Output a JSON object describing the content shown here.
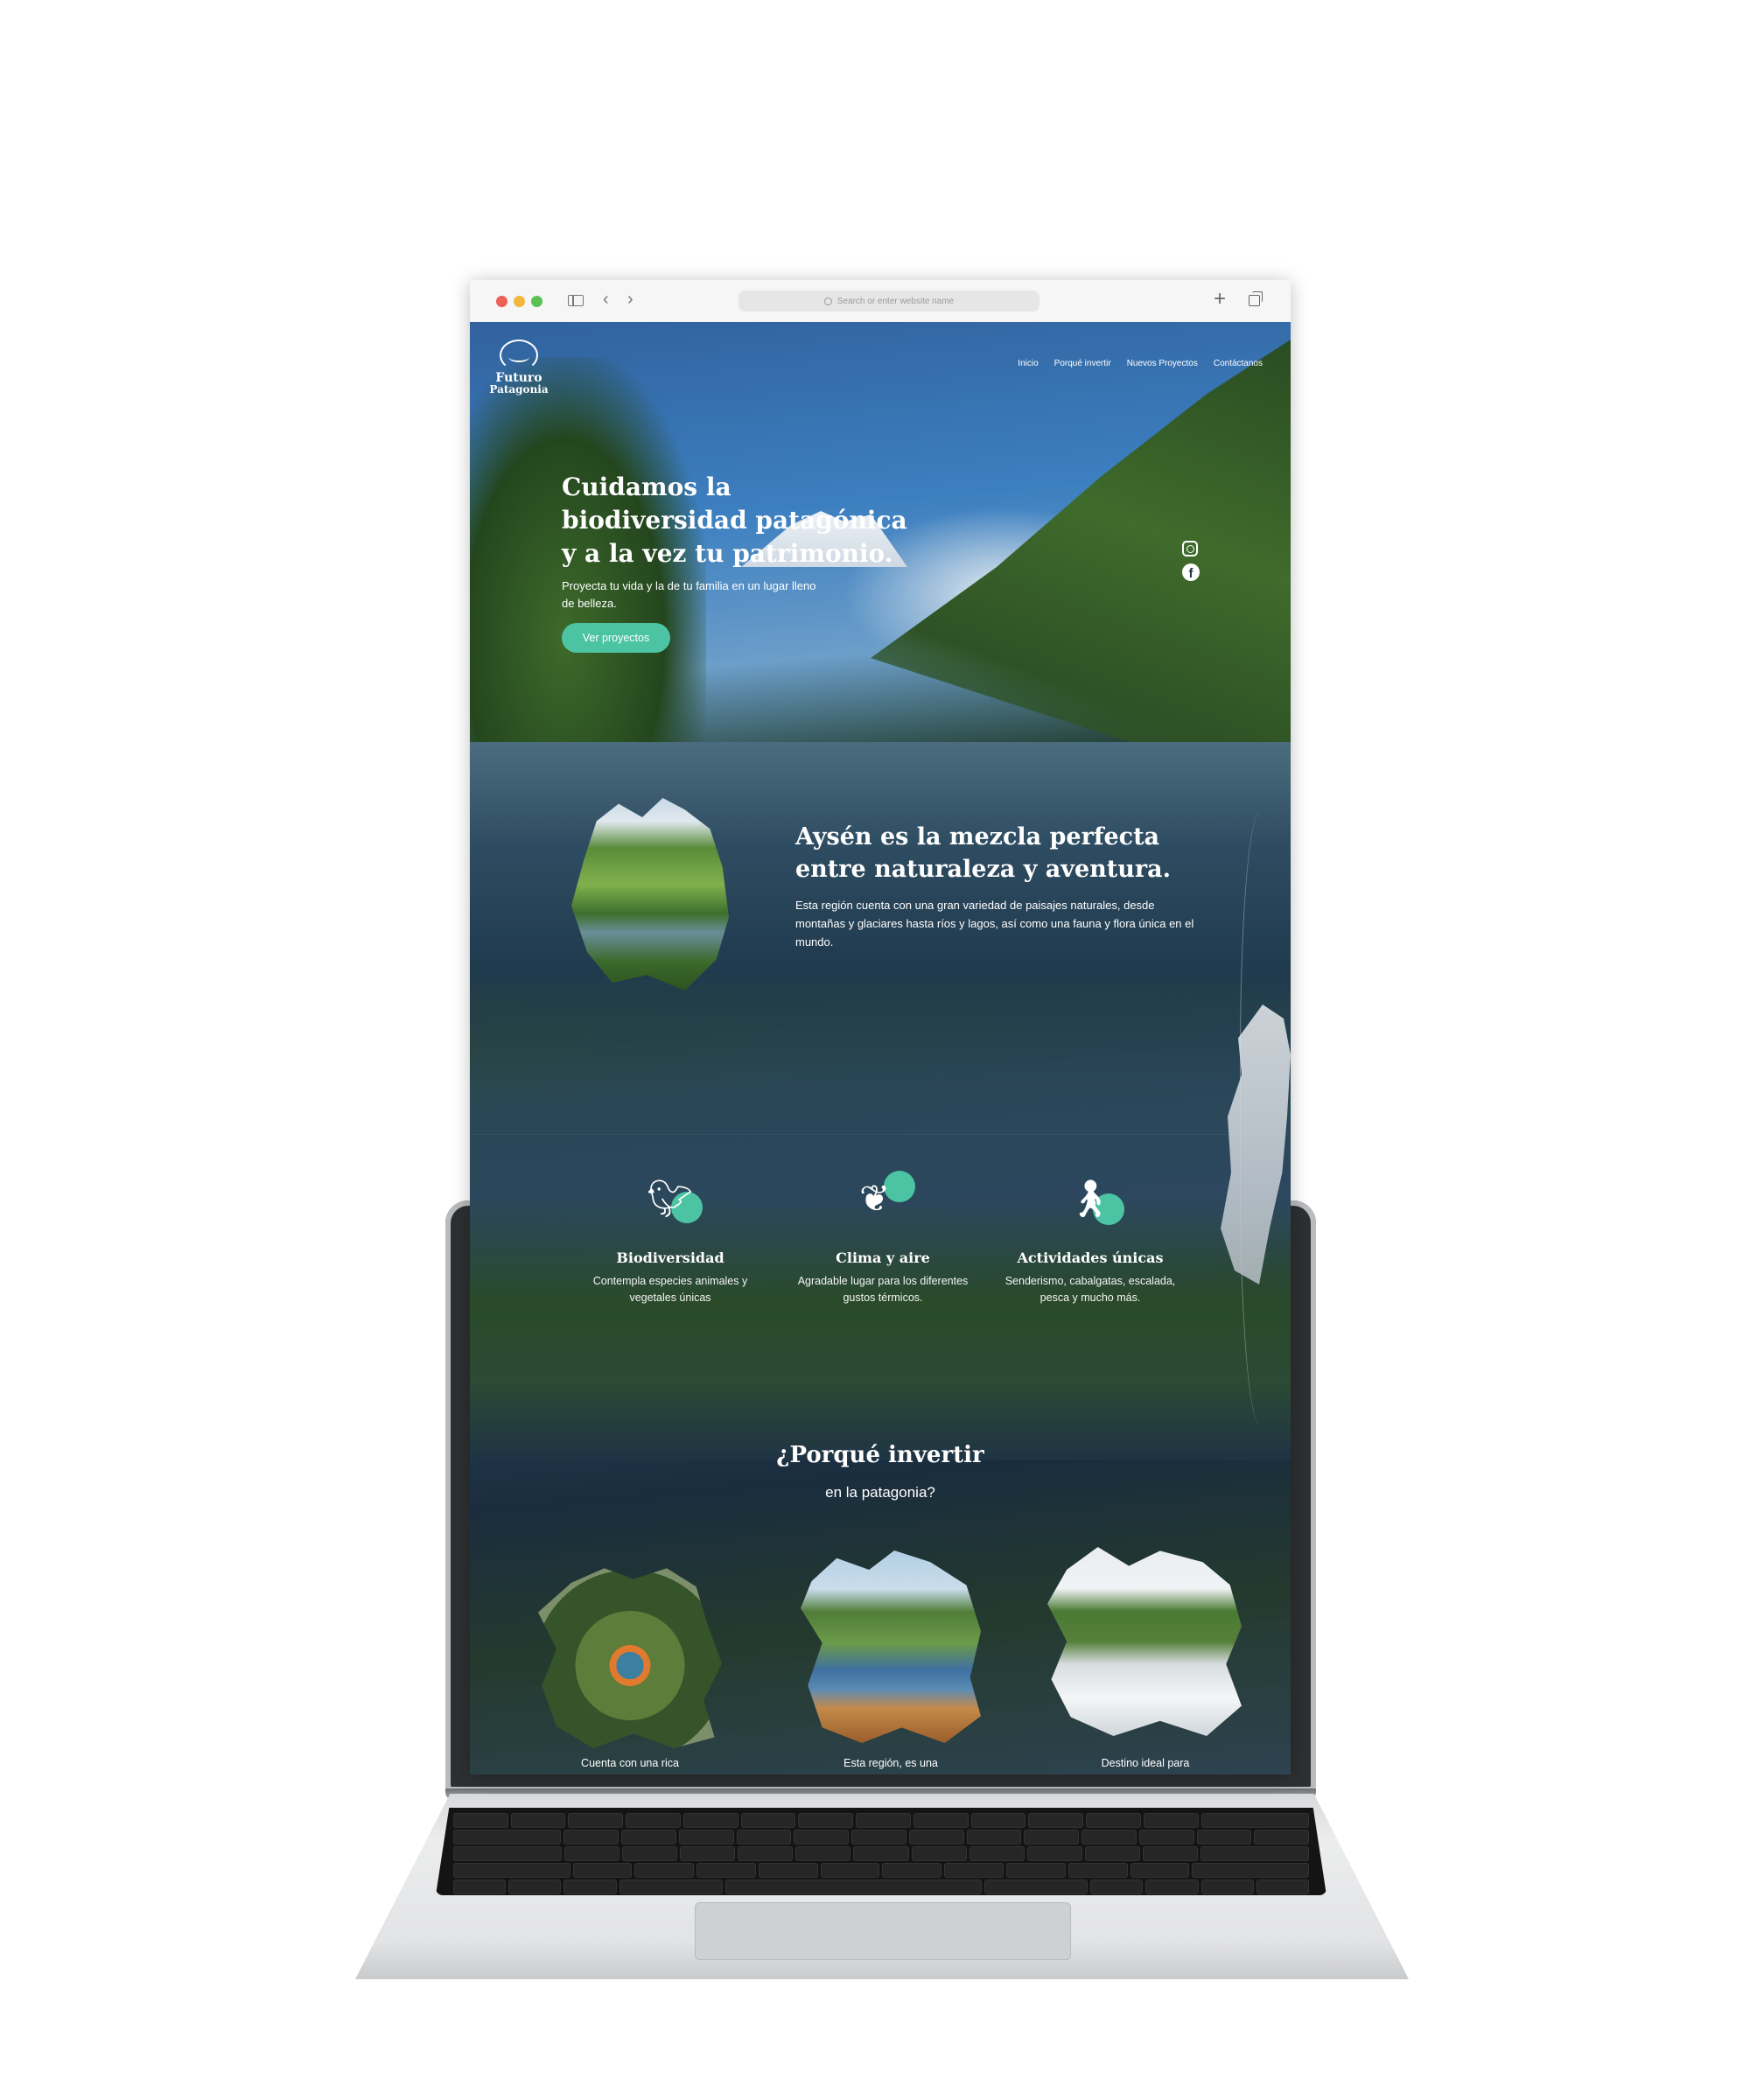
{
  "browser": {
    "address_placeholder": "Search or enter website name"
  },
  "site": {
    "logo_line1": "Futuro",
    "logo_line2": "Patagonia",
    "logo_tagline": "",
    "nav": [
      "Inicio",
      "Porqué invertir",
      "Nuevos Proyectos",
      "Contáctanos"
    ]
  },
  "hero": {
    "title": "Cuidamos la biodiversidad patagónica y a la vez tu patrimonio.",
    "subtitle": "Proyecta tu vida y la de tu familia en un lugar lleno de belleza.",
    "cta": "Ver proyectos"
  },
  "aysen": {
    "title": "Aysén es la mezcla perfecta entre naturaleza y aventura.",
    "text": "Esta región cuenta con una gran variedad de paisajes naturales, desde montañas y glaciares hasta ríos y lagos, así como una fauna y flora única en el mundo."
  },
  "features": [
    {
      "title": "Biodiversidad",
      "text": "Contempla especies animales y vegetales únicas",
      "icon": "bird-icon"
    },
    {
      "title": "Clima y aire",
      "text": "Agradable lugar para los diferentes gustos térmicos.",
      "icon": "leaf-icon"
    },
    {
      "title": "Actividades únicas",
      "text": "Senderismo, cabalgatas, escalada, pesca y mucho más.",
      "icon": "hiker-icon"
    }
  ],
  "why": {
    "title": "¿Porqué invertir",
    "subtitle": "en la patagonia?",
    "captions": [
      "Cuenta con una rica",
      "Esta región, es una",
      "Destino ideal para"
    ]
  },
  "colors": {
    "accent": "#4cc4a3",
    "page_background": "#1f3546"
  }
}
